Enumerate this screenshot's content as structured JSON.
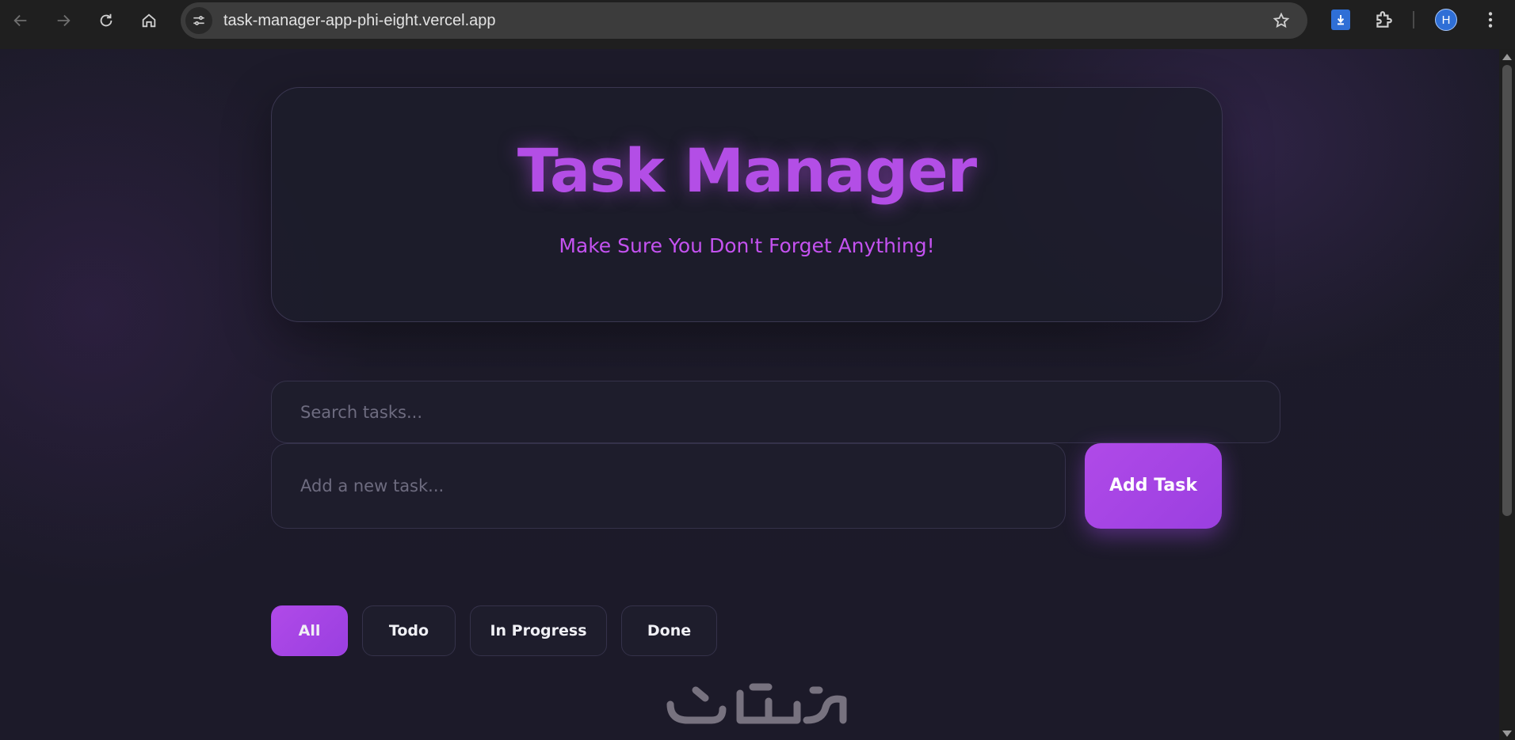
{
  "browser": {
    "url": "task-manager-app-phi-eight.vercel.app",
    "profile_initial": "H",
    "icons": [
      "back-icon",
      "forward-icon",
      "reload-icon",
      "home-icon",
      "site-settings-icon",
      "bookmark-star-icon",
      "download-extension-icon",
      "extensions-puzzle-icon",
      "menu-kebab-icon"
    ]
  },
  "app": {
    "title": "Task Manager",
    "subtitle": "Make Sure You Don't Forget Anything!",
    "search": {
      "placeholder": "Search tasks..."
    },
    "new_task": {
      "placeholder": "Add a new task..."
    },
    "add_button": "Add Task",
    "filters": [
      {
        "label": "All",
        "active": true
      },
      {
        "label": "Todo",
        "active": false
      },
      {
        "label": "In Progress",
        "active": false
      },
      {
        "label": "Done",
        "active": false
      }
    ]
  },
  "colors": {
    "accent": "#b04ae8",
    "title": "#b34ee6",
    "background": "#1c1a29",
    "card": "#1e1d2c"
  }
}
